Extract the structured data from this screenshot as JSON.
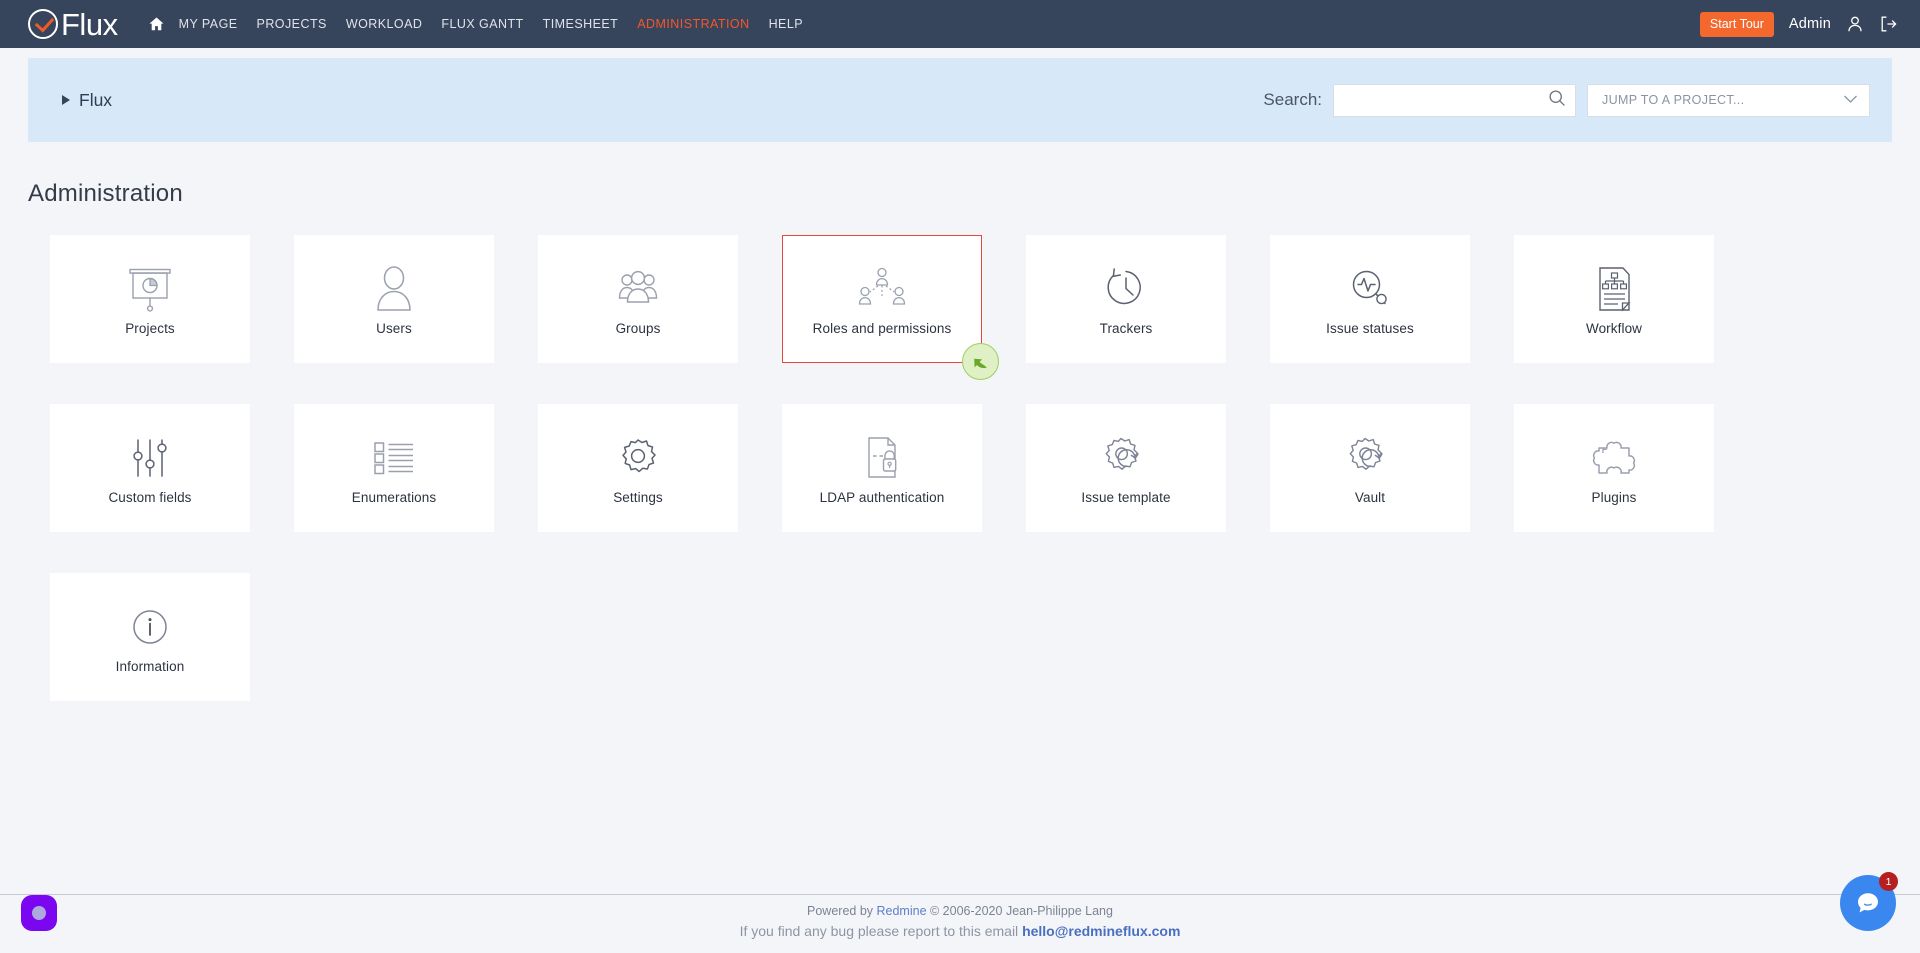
{
  "nav": {
    "brand": "Flux",
    "home_icon": "home-icon",
    "links": [
      {
        "label": "MY PAGE",
        "active": false
      },
      {
        "label": "PROJECTS",
        "active": false
      },
      {
        "label": "WORKLOAD",
        "active": false
      },
      {
        "label": "FLUX GANTT",
        "active": false
      },
      {
        "label": "TIMESHEET",
        "active": false
      },
      {
        "label": "ADMINISTRATION",
        "active": true
      },
      {
        "label": "HELP",
        "active": false
      }
    ],
    "start_tour": "Start Tour",
    "user_name": "Admin",
    "account_icon": "user-icon",
    "logout_icon": "logout-icon",
    "active_color": "#f4572a",
    "bar_color": "#36455c",
    "start_tour_color": "#f4682e"
  },
  "subbar": {
    "breadcrumb": "Flux",
    "search_label": "Search:",
    "search_value": "",
    "search_placeholder": "",
    "search_icon": "search-icon",
    "jump_to_project": "JUMP TO A PROJECT...",
    "jump_icon": "chevron-down-icon",
    "background": "#d7e8f8"
  },
  "main": {
    "title": "Administration",
    "selected_card": "Roles and permissions",
    "selected_border_color": "#e8463f",
    "cursor_badge_color": "#9ecf5f",
    "cards": [
      {
        "label": "Projects",
        "icon": "projects-board-icon",
        "selected": false
      },
      {
        "label": "Users",
        "icon": "user-silhouette-icon",
        "selected": false
      },
      {
        "label": "Groups",
        "icon": "group-people-icon",
        "selected": false
      },
      {
        "label": "Roles and permissions",
        "icon": "roles-hierarchy-icon",
        "selected": true
      },
      {
        "label": "Trackers",
        "icon": "clock-history-icon",
        "selected": false
      },
      {
        "label": "Issue statuses",
        "icon": "pulse-magnifier-icon",
        "selected": false
      },
      {
        "label": "Workflow",
        "icon": "document-flowchart-icon",
        "selected": false
      },
      {
        "label": "Custom fields",
        "icon": "sliders-icon",
        "selected": false
      },
      {
        "label": "Enumerations",
        "icon": "checklist-icon",
        "selected": false
      },
      {
        "label": "Settings",
        "icon": "gear-icon",
        "selected": false
      },
      {
        "label": "LDAP authentication",
        "icon": "document-lock-icon",
        "selected": false
      },
      {
        "label": "Issue template",
        "icon": "gear-refresh-icon",
        "selected": false
      },
      {
        "label": "Vault",
        "icon": "gear-refresh-icon",
        "selected": false
      },
      {
        "label": "Plugins",
        "icon": "puzzle-piece-icon",
        "selected": false
      },
      {
        "label": "Information",
        "icon": "info-circle-icon",
        "selected": false
      }
    ]
  },
  "footer": {
    "powered_prefix": "Powered by ",
    "redmine_link": "Redmine",
    "copyright": " © 2006-2020 Jean-Philippe Lang",
    "bug_text": "If you find any bug please report to this email ",
    "bug_email": "hello@redmineflux.com"
  },
  "widgets": {
    "purple_fab": "accessibility-fab",
    "chat_fab": "chat-icon",
    "chat_unread": "1",
    "purple_color": "#7a07f0",
    "chat_color": "#3b87f0",
    "badge_color": "#b61f1f"
  }
}
